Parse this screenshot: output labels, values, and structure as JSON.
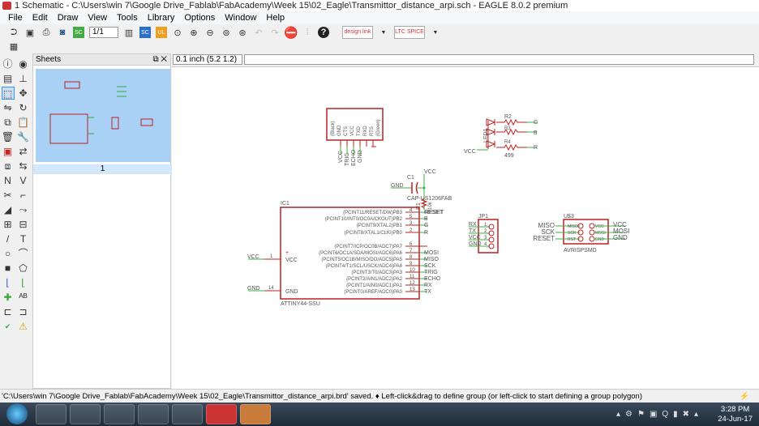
{
  "window": {
    "title": "1 Schematic - C:\\Users\\win 7\\Google Drive_Fablab\\FabAcademy\\Week 15\\02_Eagle\\Transmittor_distance_arpi.sch - EAGLE 8.0.2 premium"
  },
  "menu": [
    "File",
    "Edit",
    "Draw",
    "View",
    "Tools",
    "Library",
    "Options",
    "Window",
    "Help"
  ],
  "toolbar": {
    "sheet_select": "1/1",
    "icons": [
      "open-icon",
      "save-icon",
      "print-icon",
      "cam-icon",
      "sch-brd-icon",
      "sheet-select",
      "grid-icon",
      "sch-icon",
      "ul-icon",
      "zoom-fit-icon",
      "zoom-in-icon",
      "zoom-out-icon",
      "zoom-select-icon",
      "zoom-redraw-icon",
      "undo-icon",
      "redo-icon",
      "stop-icon",
      "go-icon",
      "help-icon",
      "designlink-icon",
      "ltspice-icon"
    ],
    "designlink": "design link",
    "ltspice": "LTC SPICE"
  },
  "sheets": {
    "title": "Sheets",
    "sheet_label": "1"
  },
  "coord": "0.1 inch (5.2 1.2)",
  "status": "'C:\\Users\\win 7\\Google Drive_Fablab\\FabAcademy\\Week 15\\02_Eagle\\Transmittor_distance_arpi.brd' saved.  ♦ Left-click&drag to define group (or left-click to start defining a group polygon)",
  "clock": {
    "time": "3:28 PM",
    "date": "24-Jun-17"
  },
  "colors": {
    "part": "#b22222",
    "net": "#3cb043",
    "text": "#555555"
  },
  "schematic": {
    "ftdi": {
      "pins": [
        "(Black)",
        "GND",
        "CTS",
        "VCC",
        "TXD",
        "RXD",
        "RTS",
        "(Green)"
      ],
      "nets": [
        "VCC",
        "TRIG",
        "ECHO",
        "GND"
      ]
    },
    "led": {
      "name": "LED1",
      "r2": "R2",
      "r3": "R3",
      "r4": "R4",
      "value": "499",
      "vcc": "VCC",
      "nets": [
        "G",
        "B",
        "R"
      ]
    },
    "cap": {
      "name": "C1",
      "value": "CAP-US1206FAB",
      "gnd": "GND",
      "vcc": "VCC"
    },
    "r1": {
      "name": "R1",
      "value": "10k",
      "net": "RESET"
    },
    "ic": {
      "name": "IC1",
      "value": "ATTINY44-SSU",
      "vcc_pin": "VCC",
      "gnd_pin": "GND",
      "vcc_net": "VCC",
      "gnd_net": "GND",
      "vcc_num": "1",
      "gnd_num": "14",
      "pins": [
        {
          "label": "(PCINT11/RESET/DW)PB3",
          "num": "4",
          "net": "RESET"
        },
        {
          "label": "(PCINT10/INT0/OC0A/CKOUT)PB2",
          "num": "5",
          "net": "B"
        },
        {
          "label": "(PCINT9/XTAL2)PB1",
          "num": "3",
          "net": "G"
        },
        {
          "label": "(PCINT8/XTAL1/CLKI)PB0",
          "num": "2",
          "net": "R"
        },
        {
          "label": "(PCINT7/ICP/OC0B/ADC7)PA7",
          "num": "6",
          "net": ""
        },
        {
          "label": "(PCINT6/OC1A/SDA/MOSI/ADC6)PA6",
          "num": "7",
          "net": "MOSI"
        },
        {
          "label": "(PCINT5/OC1B/MISO/DO/ADC5)PA5",
          "num": "8",
          "net": "MISO"
        },
        {
          "label": "(PCINT4/T1/SCL/USCK/ADC4)PA4",
          "num": "9",
          "net": "SCK"
        },
        {
          "label": "(PCINT3/T0/ADC3)PA3",
          "num": "10",
          "net": "TRIG"
        },
        {
          "label": "(PCINT2/AIN1/ADC2)PA2",
          "num": "11",
          "net": "ECHO"
        },
        {
          "label": "(PCINT1/AIN0/ADC1)PA1",
          "num": "12",
          "net": "RX"
        },
        {
          "label": "(PCINT0/AREF/ADC0)PA0",
          "num": "13",
          "net": "TX"
        }
      ]
    },
    "jp1": {
      "name": "JP1",
      "nets": [
        "RX",
        "TX",
        "VCC",
        "GND"
      ],
      "nums": [
        "1",
        "2",
        "3",
        "4"
      ]
    },
    "isp": {
      "name": "U$3",
      "value": "AVRISPSMD",
      "left_pins": [
        "MISO",
        "SCK",
        "RST"
      ],
      "right_pins": [
        "VCC",
        "MOSI",
        "GND"
      ],
      "left_nets": [
        "MISO",
        "SCK",
        "RESET"
      ],
      "right_nets": [
        "VCC",
        "MOSI",
        "GND"
      ]
    }
  }
}
